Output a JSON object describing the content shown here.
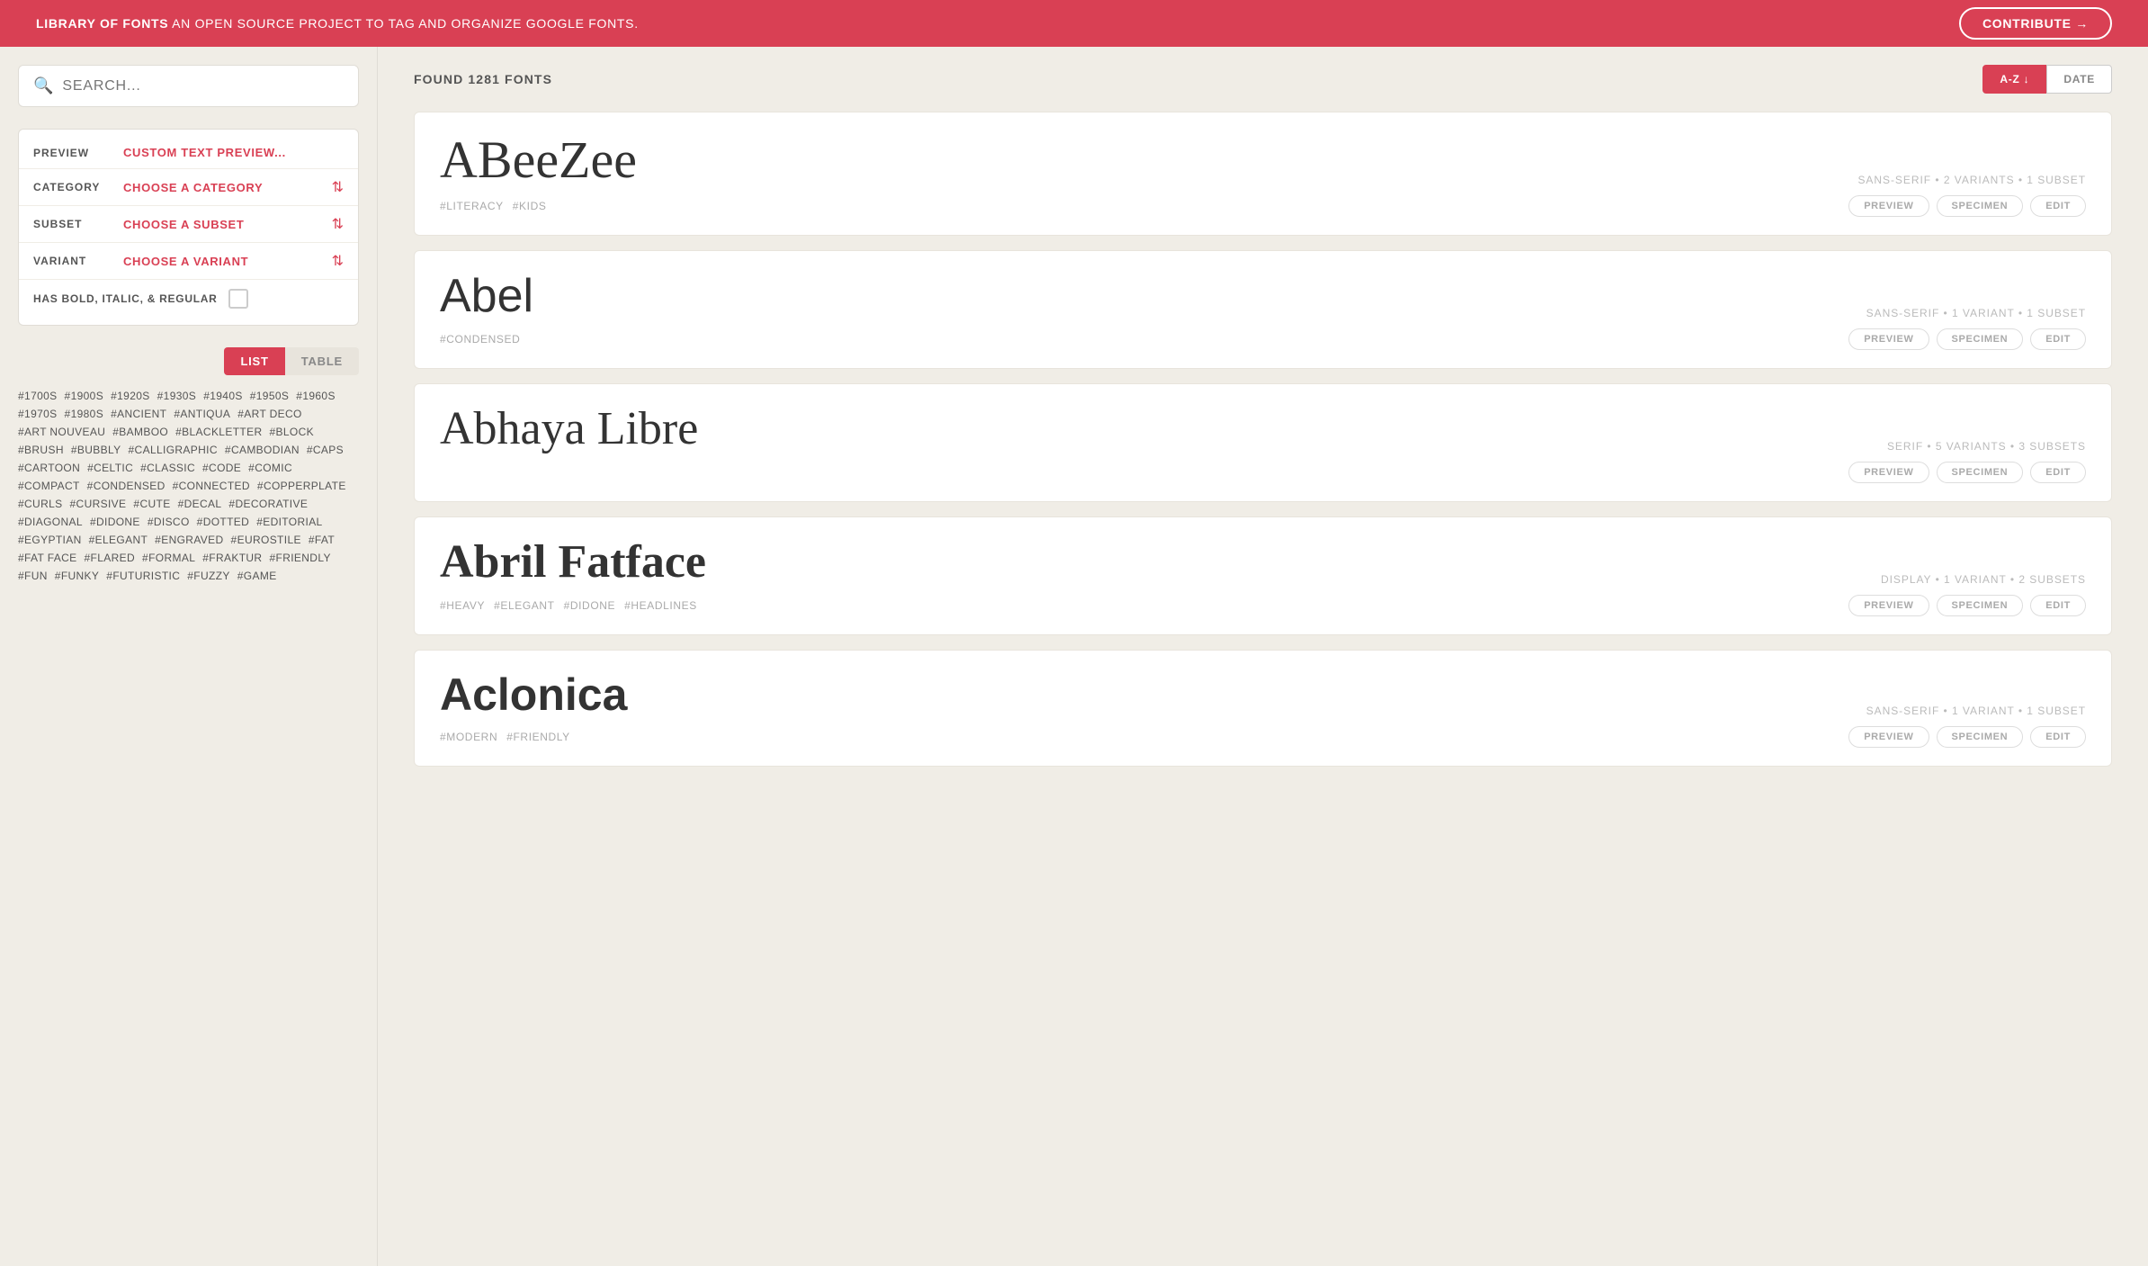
{
  "banner": {
    "title": "LIBRARY OF FONTS",
    "subtitle": "AN OPEN SOURCE PROJECT TO TAG AND ORGANIZE GOOGLE FONTS.",
    "contribute_label": "CONTRIBUTE →"
  },
  "sidebar": {
    "search_placeholder": "SEARCH...",
    "filters": [
      {
        "label": "PREVIEW",
        "value": "CUSTOM TEXT PREVIEW...",
        "has_arrow": false,
        "is_text": true
      },
      {
        "label": "CATEGORY",
        "value": "CHOOSE A CATEGORY",
        "has_arrow": true
      },
      {
        "label": "SUBSET",
        "value": "CHOOSE A SUBSET",
        "has_arrow": true
      },
      {
        "label": "VARIANT",
        "value": "CHOOSE A VARIANT",
        "has_arrow": true
      }
    ],
    "checkbox_label": "HAS BOLD, ITALIC, & REGULAR",
    "view_toggle": {
      "list_label": "LIST",
      "table_label": "TABLE"
    },
    "tags": [
      "#1700S",
      "#1900S",
      "#1920S",
      "#1930S",
      "#1940S",
      "#1950S",
      "#1960S",
      "#1970S",
      "#1980S",
      "#ANCIENT",
      "#ANTIQUA",
      "#ART DECO",
      "#ART NOUVEAU",
      "#BAMBOO",
      "#BLACKLETTER",
      "#BLOCK",
      "#BRUSH",
      "#BUBBLY",
      "#CALLIGRAPHIC",
      "#CAMBODIAN",
      "#CAPS",
      "#CARTOON",
      "#CELTIC",
      "#CLASSIC",
      "#CODE",
      "#COMIC",
      "#COMPACT",
      "#CONDENSED",
      "#CONNECTED",
      "#COPPERPLATE",
      "#CURLS",
      "#CURSIVE",
      "#CUTE",
      "#DECAL",
      "#DECORATIVE",
      "#DIAGONAL",
      "#DIDONE",
      "#DISCO",
      "#DOTTED",
      "#EDITORIAL",
      "#EGYPTIAN",
      "#ELEGANT",
      "#ENGRAVED",
      "#EUROSTILE",
      "#FAT",
      "#FAT FACE",
      "#FLARED",
      "#FORMAL",
      "#FRAKTUR",
      "#FRIENDLY",
      "#FUN",
      "#FUNKY",
      "#FUTURISTIC",
      "#FUZZY",
      "#GAME"
    ]
  },
  "content": {
    "found_text": "FOUND 1281 FONTS",
    "sort_az": "A-Z ↓",
    "sort_date": "DATE",
    "fonts": [
      {
        "name": "ABeeZee",
        "style_class": "abeezee",
        "meta": "SANS-SERIF • 2 VARIANTS • 1 SUBSET",
        "tags": [
          "#LITERACY",
          "#KIDS"
        ],
        "actions": [
          "PREVIEW",
          "SPECIMEN",
          "EDIT"
        ]
      },
      {
        "name": "Abel",
        "style_class": "abel",
        "meta": "SANS-SERIF • 1 VARIANT • 1 SUBSET",
        "tags": [
          "#CONDENSED"
        ],
        "actions": [
          "PREVIEW",
          "SPECIMEN",
          "EDIT"
        ]
      },
      {
        "name": "Abhaya Libre",
        "style_class": "abhaya",
        "meta": "SERIF • 5 VARIANTS • 3 SUBSETS",
        "tags": [],
        "actions": [
          "PREVIEW",
          "SPECIMEN",
          "EDIT"
        ]
      },
      {
        "name": "Abril Fatface",
        "style_class": "abril",
        "meta": "DISPLAY • 1 VARIANT • 2 SUBSETS",
        "tags": [
          "#HEAVY",
          "#ELEGANT",
          "#DIDONE",
          "#HEADLINES"
        ],
        "actions": [
          "PREVIEW",
          "SPECIMEN",
          "EDIT"
        ]
      },
      {
        "name": "Aclonica",
        "style_class": "aclonica",
        "meta": "SANS-SERIF • 1 VARIANT • 1 SUBSET",
        "tags": [
          "#MODERN",
          "#FRIENDLY"
        ],
        "actions": [
          "PREVIEW",
          "SPECIMEN",
          "EDIT"
        ]
      }
    ]
  }
}
